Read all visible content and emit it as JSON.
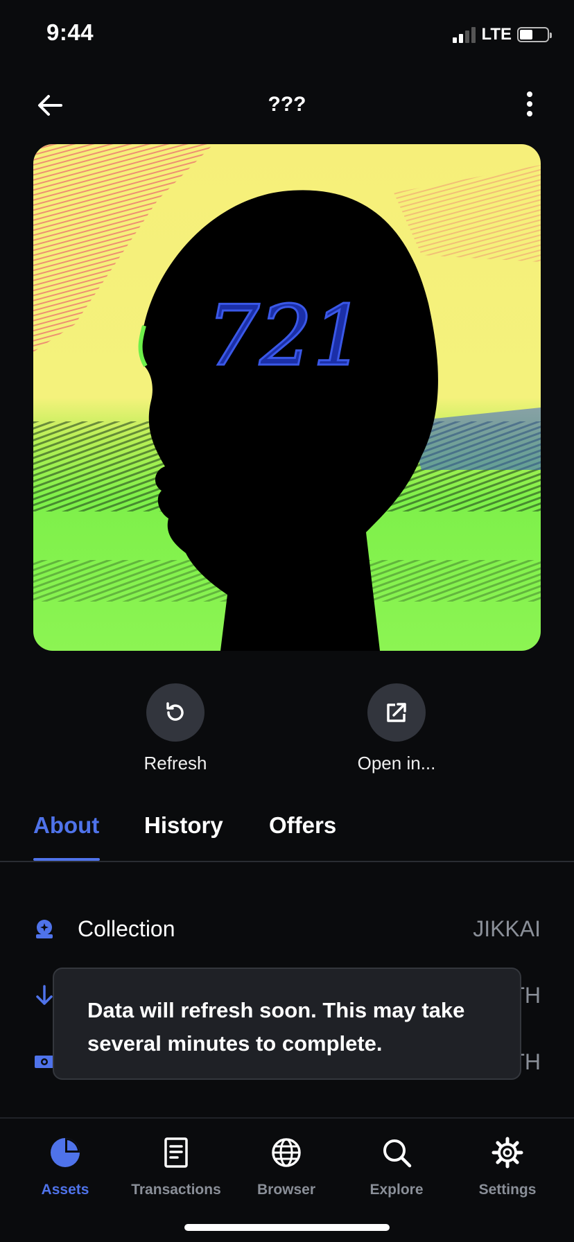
{
  "status_bar": {
    "time": "9:44",
    "network": "LTE"
  },
  "header": {
    "title": "???"
  },
  "nft": {
    "art_text": "721"
  },
  "actions": {
    "refresh_label": "Refresh",
    "open_label": "Open in..."
  },
  "tabs": [
    {
      "label": "About",
      "active": true
    },
    {
      "label": "History",
      "active": false
    },
    {
      "label": "Offers",
      "active": false
    }
  ],
  "details": [
    {
      "label": "Collection",
      "value": "JIKKAI",
      "icon": "collection-icon"
    },
    {
      "label": "",
      "value": "TH",
      "icon": "arrow-down-icon"
    },
    {
      "label": "",
      "value": "TH",
      "icon": "cash-icon"
    }
  ],
  "toast": {
    "message": "Data will refresh soon. This may take several minutes to complete."
  },
  "bottom_nav": [
    {
      "label": "Assets",
      "icon": "pie-chart-icon",
      "active": true
    },
    {
      "label": "Transactions",
      "icon": "document-icon",
      "active": false
    },
    {
      "label": "Browser",
      "icon": "globe-icon",
      "active": false
    },
    {
      "label": "Explore",
      "icon": "search-icon",
      "active": false
    },
    {
      "label": "Settings",
      "icon": "gear-icon",
      "active": false
    }
  ],
  "colors": {
    "accent": "#4f73ea",
    "background": "#0a0b0d",
    "toast_bg": "#1f2126"
  }
}
